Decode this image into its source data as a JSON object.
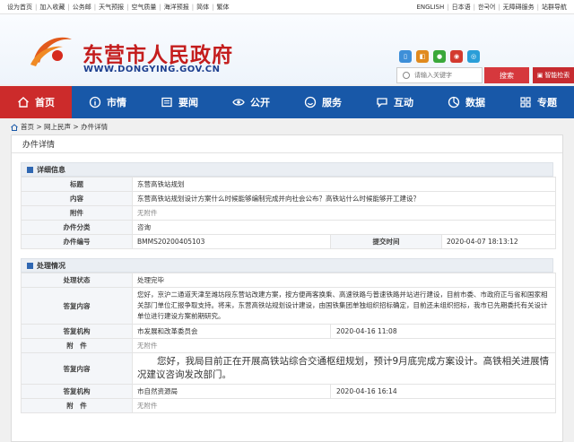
{
  "topbar": {
    "left": [
      "设为首页",
      "加入收藏",
      "公务邮",
      "天气预报",
      "空气质量",
      "海洋预报",
      "简体",
      "繁体"
    ],
    "right": [
      "ENGLISH",
      "日本语",
      "한국어",
      "无障碍服务",
      "站群导航"
    ]
  },
  "header": {
    "site_name": "东营市人民政府",
    "site_url": "WWW.DONGYING.GOV.CN",
    "search_placeholder": "请输入关键字",
    "search_button": "搜索",
    "smart_button": "智能检索"
  },
  "colors": {
    "nav_blue": "#1858a8",
    "nav_active": "#cc2b2b",
    "accent_red": "#c41d1d"
  },
  "nav": [
    {
      "label": "首页",
      "icon": "home-icon"
    },
    {
      "label": "市情",
      "icon": "info-icon"
    },
    {
      "label": "要闻",
      "icon": "news-icon"
    },
    {
      "label": "公开",
      "icon": "eye-icon"
    },
    {
      "label": "服务",
      "icon": "service-icon"
    },
    {
      "label": "互动",
      "icon": "interact-icon"
    },
    {
      "label": "数据",
      "icon": "data-icon"
    },
    {
      "label": "专题",
      "icon": "topic-icon"
    }
  ],
  "breadcrumb": "首页 > 网上民声 > 办件详情",
  "panel_title": "办件详情",
  "detail": {
    "heading": "详细信息",
    "title_label": "标题",
    "title_value": "东营高铁站规划",
    "content_label": "内容",
    "content_value": "东营高铁站规划设计方案什么时候能够编制完成并向社会公布？高铁站什么时候能够开工建设？",
    "attach_label": "附件",
    "attach_value": "无附件",
    "category_label": "办件分类",
    "category_value": "咨询",
    "number_label": "办件编号",
    "number_value": "BMMS20200405103",
    "submit_label": "提交时间",
    "submit_value": "2020-04-07 18:13:12"
  },
  "handling": {
    "heading": "处理情况",
    "status_label": "处理状态",
    "status_value": "处理完毕",
    "reply1_label": "答复内容",
    "reply1_value": "您好，京沪二通道天津至潍坊段东营站改建方案，按方便两客换乘、高速铁路与普速铁路并站进行建设，目前市委、市政府正与省和国家相关部门单位汇报争取支持。将来，东营高铁站规划设计建设，由国铁集团单独组织招标确定，目前还未组织招标，我市已先期委托有关设计单位进行建设方案前期研究。",
    "org1_label": "答复机构",
    "org1_value": "市发展和改革委员会",
    "date1_value": "2020-04-16 11:08",
    "attach1_label": "附　件",
    "attach1_value": "无附件",
    "reply2_label": "答复内容",
    "reply2_value": "您好，我局目前正在开展高铁站综合交通枢纽规划，预计9月底完成方案设计。高铁相关进展情况建议咨询发改部门。",
    "org2_label": "答复机构",
    "org2_value": "市自然资源局",
    "date2_value": "2020-04-16 16:14",
    "attach2_label": "附　件",
    "attach2_value": "无附件"
  }
}
